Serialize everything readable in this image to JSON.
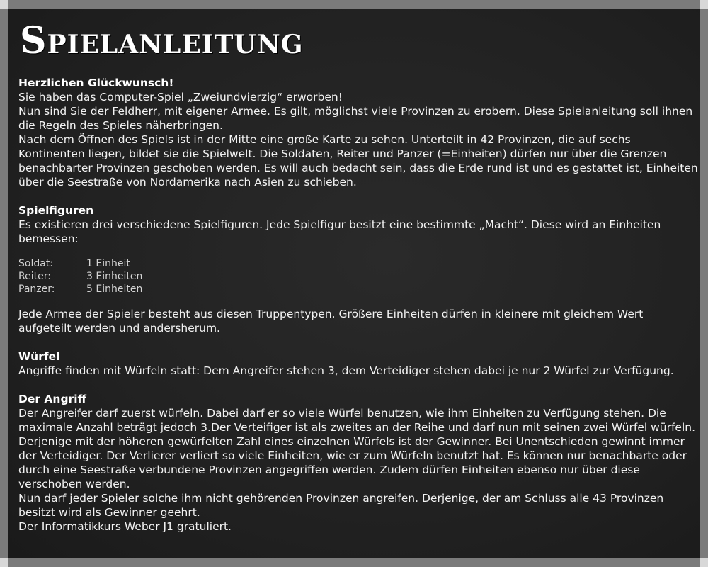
{
  "title": "Spielanleitung",
  "intro": {
    "heading": "Herzlichen Glückwunsch!",
    "lines": [
      "Sie haben das Computer-Spiel „Zweiundvierzig“ erworben!",
      "Nun sind Sie der Feldherr, mit eigener Armee. Es gilt, möglichst viele Provinzen zu erobern. Diese Spielanleitung soll ihnen die Regeln des Spieles näherbringen.",
      "Nach dem Öffnen des Spiels ist in der Mitte eine große Karte zu sehen. Unterteilt in 42 Provinzen, die auf sechs Kontinenten liegen, bildet sie die Spielwelt. Die Soldaten, Reiter und Panzer (=Einheiten) dürfen nur über die Grenzen benachbarter Provinzen geschoben werden. Es will auch bedacht sein, dass die Erde rund ist und es gestattet ist, Einheiten über die Seestraße von Nordamerika nach Asien zu schieben."
    ]
  },
  "spielfiguren": {
    "heading": "Spielfiguren",
    "text": "Es existieren drei verschiedene Spielfiguren. Jede Spielfigur besitzt eine bestimmte „Macht“. Diese wird an Einheiten bemessen:",
    "units": [
      {
        "name": "Soldat:",
        "value": "1 Einheit"
      },
      {
        "name": "Reiter:",
        "value": "3 Einheiten"
      },
      {
        "name": "Panzer:",
        "value": "5 Einheiten"
      }
    ],
    "after": "Jede Armee der Spieler besteht aus diesen Truppentypen. Größere Einheiten dürfen in kleinere mit gleichem Wert aufgeteilt werden und andersherum."
  },
  "wuerfel": {
    "heading": "Würfel",
    "text": "Angriffe finden mit Würfeln statt: Dem Angreifer stehen 3, dem Verteidiger stehen dabei je nur 2 Würfel zur Verfügung."
  },
  "angriff": {
    "heading": "Der Angriff",
    "lines": [
      "Der Angreifer darf zuerst würfeln. Dabei darf er so viele Würfel benutzen, wie ihm Einheiten zu Verfügung stehen. Die maximale Anzahl beträgt jedoch 3.Der Verteifiger ist als zweites an der Reihe und darf nun mit seinen zwei Würfel würfeln. Derjenige mit der höheren gewürfelten Zahl eines einzelnen Würfels ist der Gewinner. Bei Unentschieden gewinnt immer der Verteidiger. Der Verlierer verliert so viele Einheiten, wie er zum Würfeln benutzt hat. Es können nur benachbarte oder durch eine Seestraße verbundene Provinzen angegriffen werden. Zudem dürfen Einheiten ebenso nur über diese verschoben werden.",
      "Nun darf jeder Spieler solche ihm nicht gehörenden Provinzen angreifen. Derjenige, der am Schluss alle 43 Provinzen besitzt wird als Gewinner geehrt.",
      "Der Informatikkurs Weber J1 gratuliert."
    ]
  }
}
